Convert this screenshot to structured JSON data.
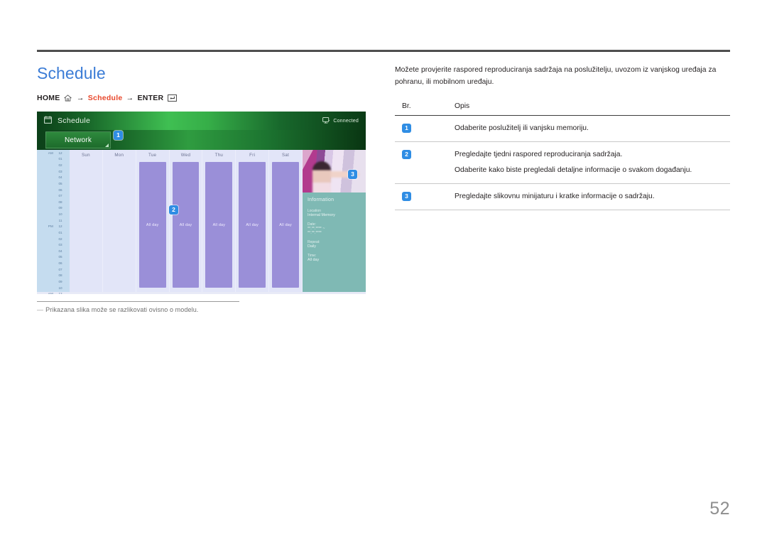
{
  "doc": {
    "title": "Schedule",
    "page_number": "52"
  },
  "breadcrumb": {
    "home": "HOME",
    "home_icon": "home-icon",
    "arrow": "→",
    "current": "Schedule",
    "enter": "ENTER",
    "enter_icon": "enter-key-icon"
  },
  "screenshot": {
    "topbar": {
      "calendar_icon": "calendar-icon",
      "title": "Schedule",
      "monitor_icon": "monitor-icon",
      "connected_label": "Connected"
    },
    "source_button": {
      "label": "Network",
      "badge": "1"
    },
    "calendar": {
      "badge": "2",
      "meridiems": [
        "AM",
        "PM",
        "AM"
      ],
      "hours": [
        "12",
        "01",
        "02",
        "03",
        "04",
        "05",
        "06",
        "07",
        "08",
        "09",
        "10",
        "11"
      ],
      "days": [
        "Sun",
        "Mon",
        "Tue",
        "Wed",
        "Thu",
        "Fri",
        "Sat"
      ],
      "events": [
        {
          "day": "Sun",
          "has_event": false,
          "label": ""
        },
        {
          "day": "Mon",
          "has_event": false,
          "label": ""
        },
        {
          "day": "Tue",
          "has_event": true,
          "label": "All day"
        },
        {
          "day": "Wed",
          "has_event": true,
          "label": "All day"
        },
        {
          "day": "Thu",
          "has_event": true,
          "label": "All day"
        },
        {
          "day": "Fri",
          "has_event": true,
          "label": "All day"
        },
        {
          "day": "Sat",
          "has_event": true,
          "label": "All day"
        }
      ]
    },
    "information": {
      "badge": "3",
      "heading": "Information",
      "location_key": "Location",
      "location_value": "Internal Memory",
      "date_key": "Date:",
      "date_value_1": "**.**.**** ~",
      "date_value_2": "**.**.****",
      "repeat_key": "Repeat:",
      "repeat_value": "Daily",
      "time_key": "Time:",
      "time_value": "All day"
    }
  },
  "footnote": {
    "dash": "—",
    "text": "Prikazana slika može se razlikovati ovisno o modelu."
  },
  "content": {
    "intro": "Možete provjerite raspored reproduciranja sadržaja na poslužitelju, uvozom iz vanjskog uređaja za pohranu, ili mobilnom uređaju.",
    "table": {
      "headers": [
        "Br.",
        "Opis"
      ],
      "rows": [
        {
          "no": "1",
          "lines": [
            "Odaberite poslužitelj ili vanjsku memoriju."
          ]
        },
        {
          "no": "2",
          "lines": [
            "Pregledajte tjedni raspored reproduciranja sadržaja.",
            "Odaberite kako biste pregledali detaljne informacije o svakom događanju."
          ]
        },
        {
          "no": "3",
          "lines": [
            "Pregledajte slikovnu minijaturu i kratke informacije o sadržaju."
          ]
        }
      ]
    }
  },
  "colors": {
    "title_blue": "#3b7cd6",
    "crumb_orange": "#e8472b",
    "badge_blue": "#2f8de4",
    "event_purple": "#9a8fd8",
    "info_teal": "#7fb9b4"
  }
}
